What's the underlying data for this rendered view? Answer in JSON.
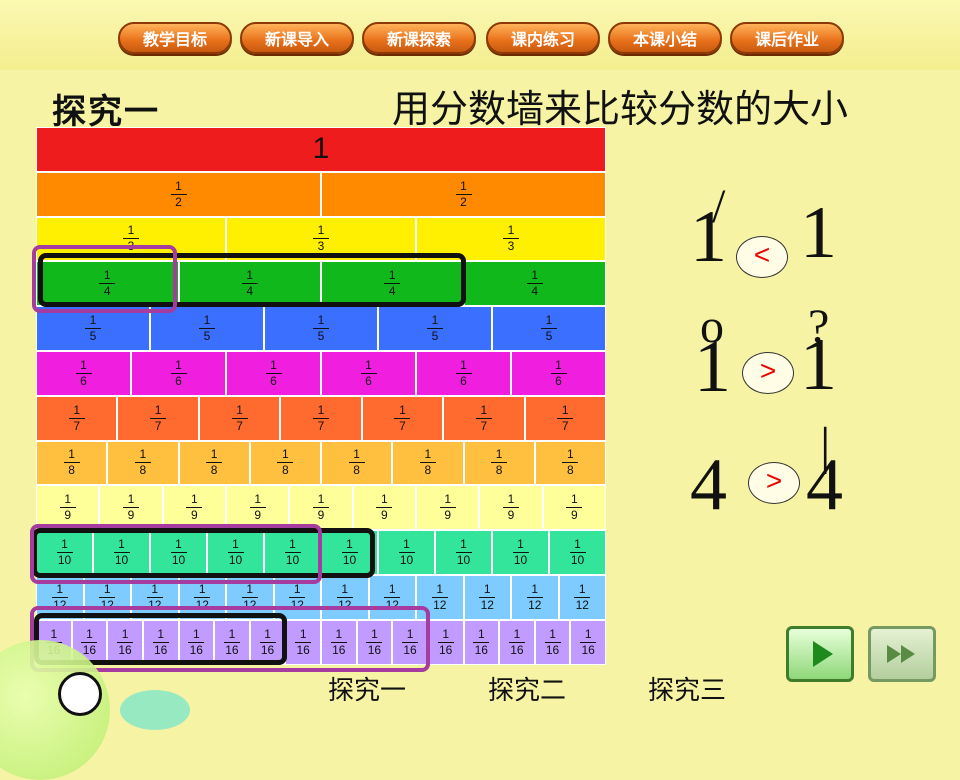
{
  "nav": {
    "buttons": [
      "教学目标",
      "新课导入",
      "新课探索",
      "课内练习",
      "本课小结",
      "课后作业"
    ]
  },
  "heading": {
    "section": "探究一",
    "subtitle": "用分数墙来比较分数的大小"
  },
  "fraction_wall": {
    "rows": [
      {
        "denominator": 1,
        "color": "#ee1c1c",
        "label": "1"
      },
      {
        "denominator": 2,
        "color": "#ff8a00"
      },
      {
        "denominator": 3,
        "color": "#ffef00"
      },
      {
        "denominator": 4,
        "color": "#11b81c"
      },
      {
        "denominator": 5,
        "color": "#3a6fff"
      },
      {
        "denominator": 6,
        "color": "#f01fe0"
      },
      {
        "denominator": 7,
        "color": "#ff6a2e"
      },
      {
        "denominator": 8,
        "color": "#ffc040"
      },
      {
        "denominator": 9,
        "color": "#ffff99"
      },
      {
        "denominator": 10,
        "color": "#33e59a"
      },
      {
        "denominator": 12,
        "color": "#7ecbff"
      },
      {
        "denominator": 16,
        "color": "#c19bff"
      }
    ]
  },
  "comparisons": [
    {
      "symbol": "<"
    },
    {
      "symbol": ">"
    },
    {
      "symbol": ">"
    }
  ],
  "bottom_nav": [
    "探究一",
    "探究二",
    "探究三"
  ],
  "colors": {
    "background": "#f6f3a5",
    "highlight_purple": "#a63ba0",
    "highlight_black": "#111111",
    "compare_red": "#ee0000"
  },
  "icons": [
    "play-icon",
    "fast-forward-icon"
  ]
}
